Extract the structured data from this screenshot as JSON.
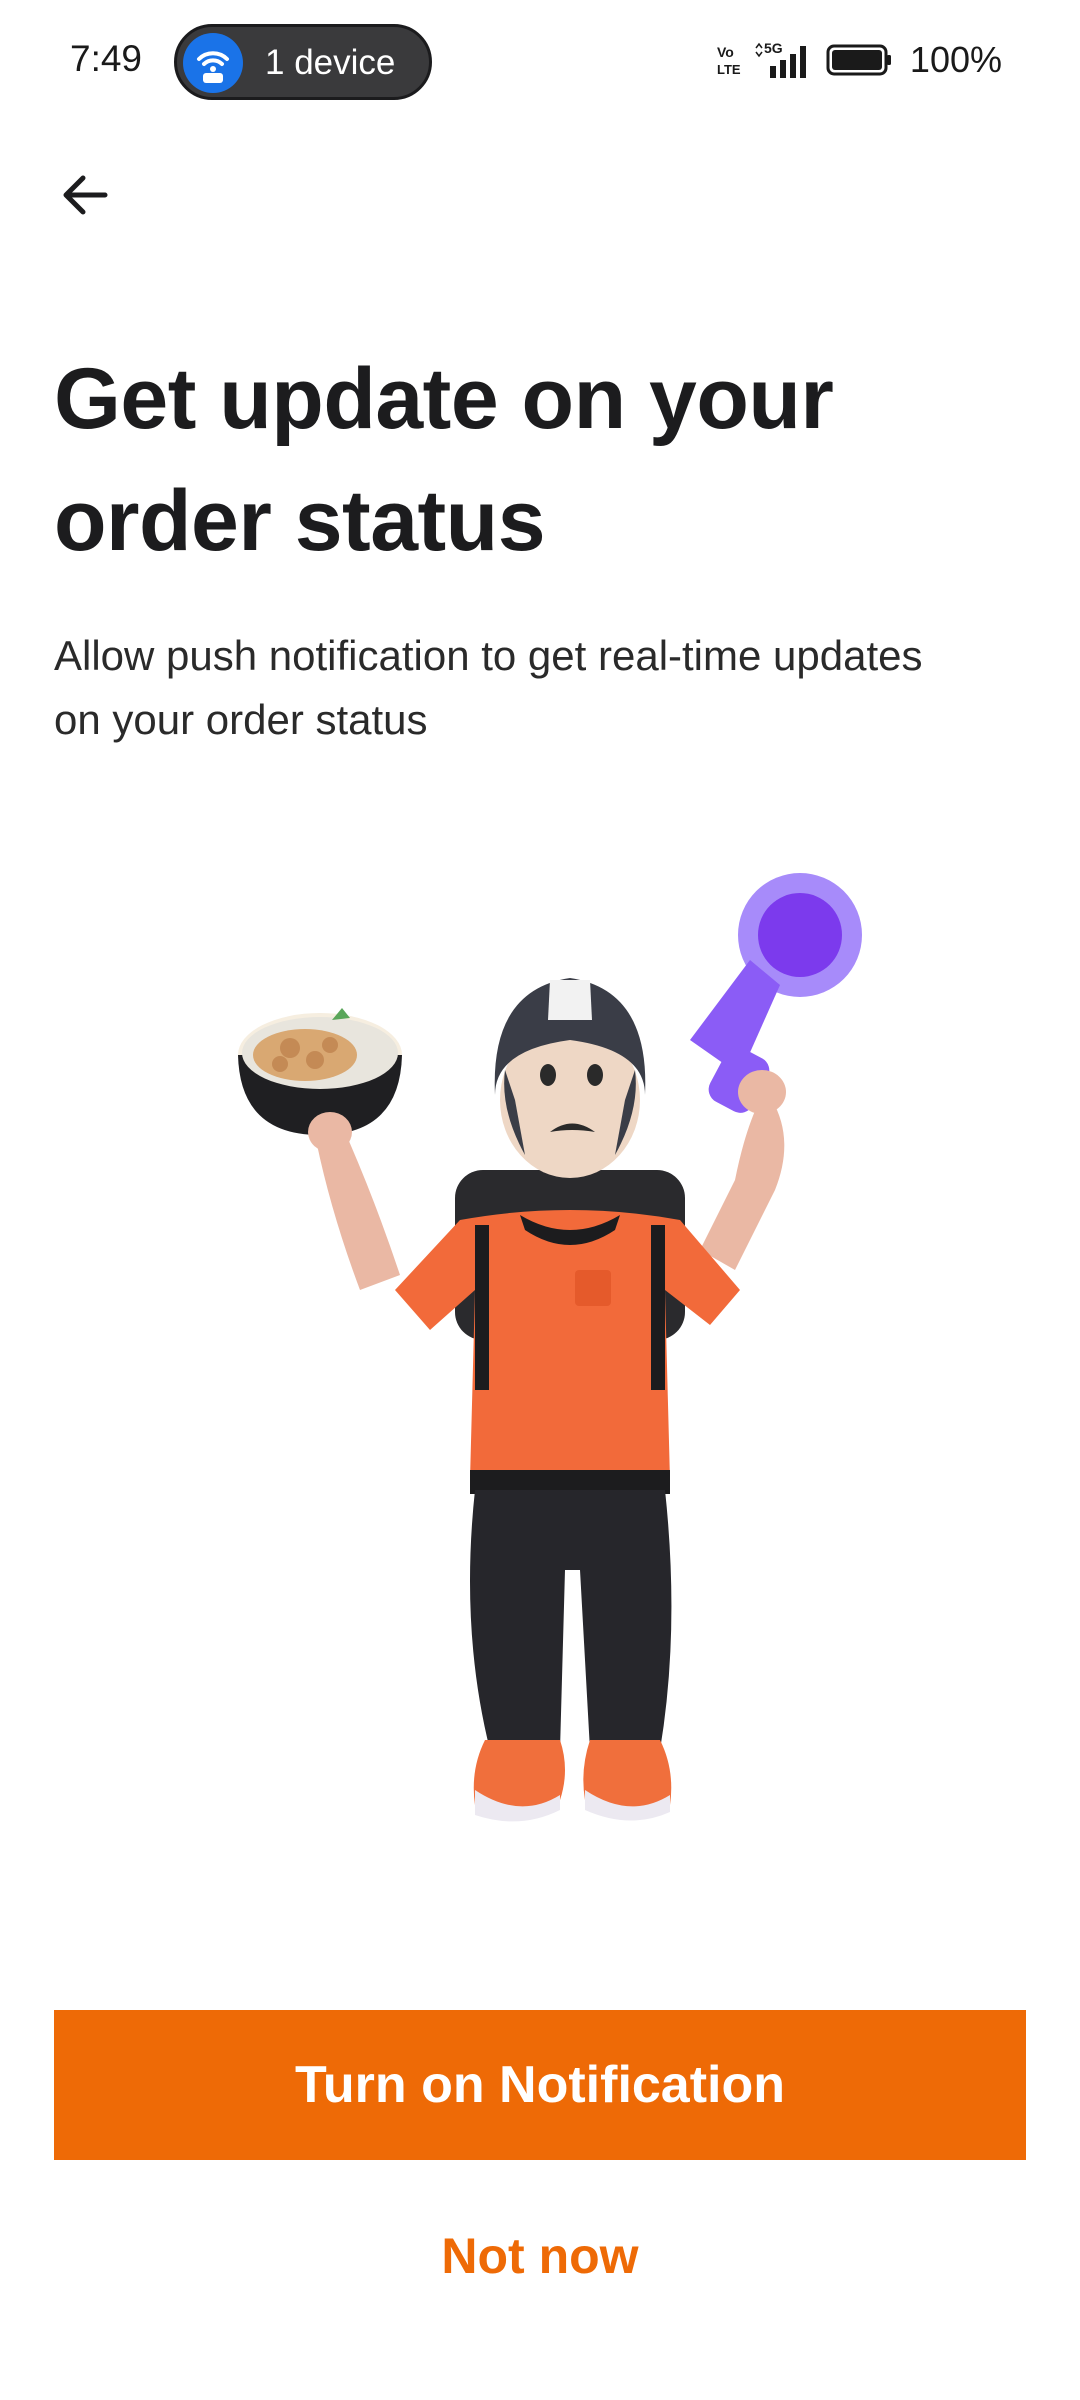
{
  "status_bar": {
    "time": "7:49",
    "hotspot_label": "1 device",
    "battery_text": "100%",
    "network_label": "5G",
    "volte_label": "Vo LTE"
  },
  "header": {
    "back_icon": "arrow-left-icon"
  },
  "content": {
    "title": "Get update on your order status",
    "subtitle": "Allow push notification to get real-time updates on your order status"
  },
  "illustration": {
    "description_icon": "delivery-person-with-food-bowl-and-megaphone"
  },
  "actions": {
    "primary_label": "Turn on Notification",
    "secondary_label": "Not now"
  },
  "colors": {
    "accent": "#ee6a06",
    "title": "#1c1c1e",
    "hotspot_blue": "#1a73e8",
    "pill_bg": "#3a3a3c",
    "megaphone": "#8b5cf6"
  }
}
